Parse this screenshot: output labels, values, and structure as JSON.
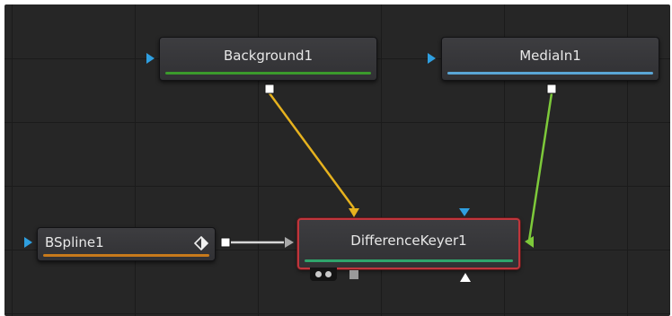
{
  "nodes": {
    "background": {
      "label": "Background1",
      "bar_color": "#3b9a2c"
    },
    "mediain": {
      "label": "MediaIn1",
      "bar_color": "#5aa6d6"
    },
    "bspline": {
      "label": "BSpline1",
      "bar_color": "#c77a1c"
    },
    "keyer": {
      "label": "DifferenceKeyer1",
      "bar_color": "#2fa56c",
      "selection_color": "#c0363c"
    }
  },
  "connections": [
    {
      "from": "Background1",
      "to": "DifferenceKeyer1",
      "color": "#e6b21e"
    },
    {
      "from": "MediaIn1",
      "to": "DifferenceKeyer1",
      "color": "#7dc93a"
    },
    {
      "from": "BSpline1",
      "to": "DifferenceKeyer1",
      "color": "#d8d8d8"
    }
  ],
  "colors": {
    "canvas": "#262626",
    "input_arrow": "#2f9fe0",
    "output_square": "#ffffff"
  },
  "icons": [
    "input-arrow-icon",
    "output-square-icon",
    "keyframe-diamond-icon",
    "mask-input-icon",
    "triangle-up-icon"
  ]
}
